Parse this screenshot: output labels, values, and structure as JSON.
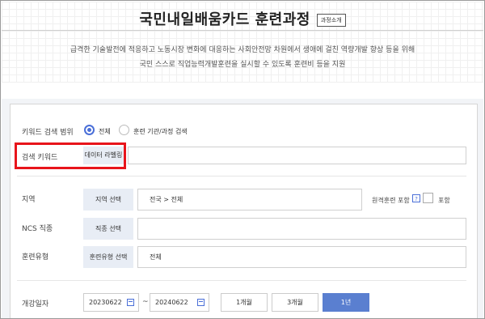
{
  "header": {
    "title": "국민내일배움카드 훈련과정",
    "intro_button": "과정소개",
    "desc_line1": "급격한 기술발전에 적응하고 노동시장 변화에 대응하는 사회안전망 차원에서 생애에 걸친 역량개발 향상 등을 위해",
    "desc_line2": "국민 스스로 직업능력개발훈련을 실시할 수 있도록 훈련비 등을 지원"
  },
  "form": {
    "keyword_scope_label": "키워드 검색 범위",
    "scope_options": [
      "전체",
      "훈련 기관/과정 검색"
    ],
    "scope_selected": "전체",
    "keyword_label": "검색 키워드",
    "keyword_value": "데이터 라벨링",
    "region_label": "지역",
    "region_button": "지역 선택",
    "region_value": "전국 > 전체",
    "remote_label": "원격훈련 포함",
    "help_icon": "?",
    "include_label": "포함",
    "ncs_label": "NCS 직종",
    "ncs_button": "직종 선택",
    "ncs_value": "",
    "type_label": "훈련유형",
    "type_button": "훈련유형 선택",
    "type_value": "전체",
    "date_label": "개강일자",
    "date_from": "20230622",
    "date_sep": "~",
    "date_to": "20240622",
    "period_buttons": [
      "1개월",
      "3개월",
      "1년"
    ],
    "period_selected": "1년"
  },
  "colors": {
    "accent": "#4a6fd8",
    "highlight": "#e8141b",
    "chip_bg": "#e8edf5"
  }
}
